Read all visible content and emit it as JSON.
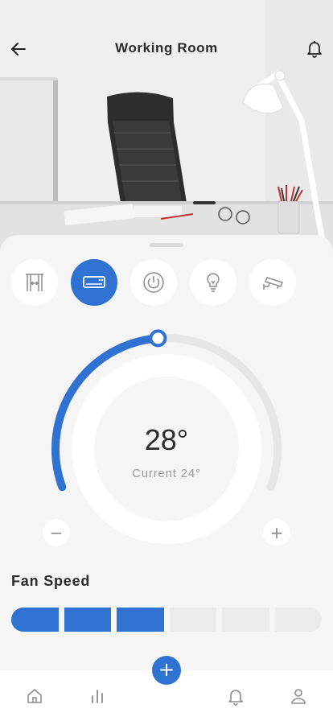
{
  "header": {
    "title": "Working Room",
    "back_icon": "arrow-left-icon",
    "notification_icon": "bell-icon"
  },
  "devices": [
    {
      "name": "curtain",
      "icon": "curtain-icon",
      "active": false
    },
    {
      "name": "air-conditioner",
      "icon": "air-conditioner-icon",
      "active": true
    },
    {
      "name": "power",
      "icon": "power-icon",
      "active": false
    },
    {
      "name": "light",
      "icon": "bulb-icon",
      "active": false
    },
    {
      "name": "camera",
      "icon": "cctv-icon",
      "active": false
    }
  ],
  "thermostat": {
    "set_temp": "28°",
    "current": "Current 24°",
    "level_fraction": 0.48,
    "minus": "−",
    "plus": "+"
  },
  "fan_speed": {
    "label": "Fan Speed",
    "segments_total": 6,
    "segments_on": 3
  },
  "nav": {
    "items": [
      "home-icon",
      "stats-icon",
      "bell-icon",
      "user-icon"
    ],
    "fab_label": "+"
  },
  "colors": {
    "accent": "#2f72d2",
    "track": "#e6e6e6",
    "icon_gray": "#8c8c8c"
  }
}
